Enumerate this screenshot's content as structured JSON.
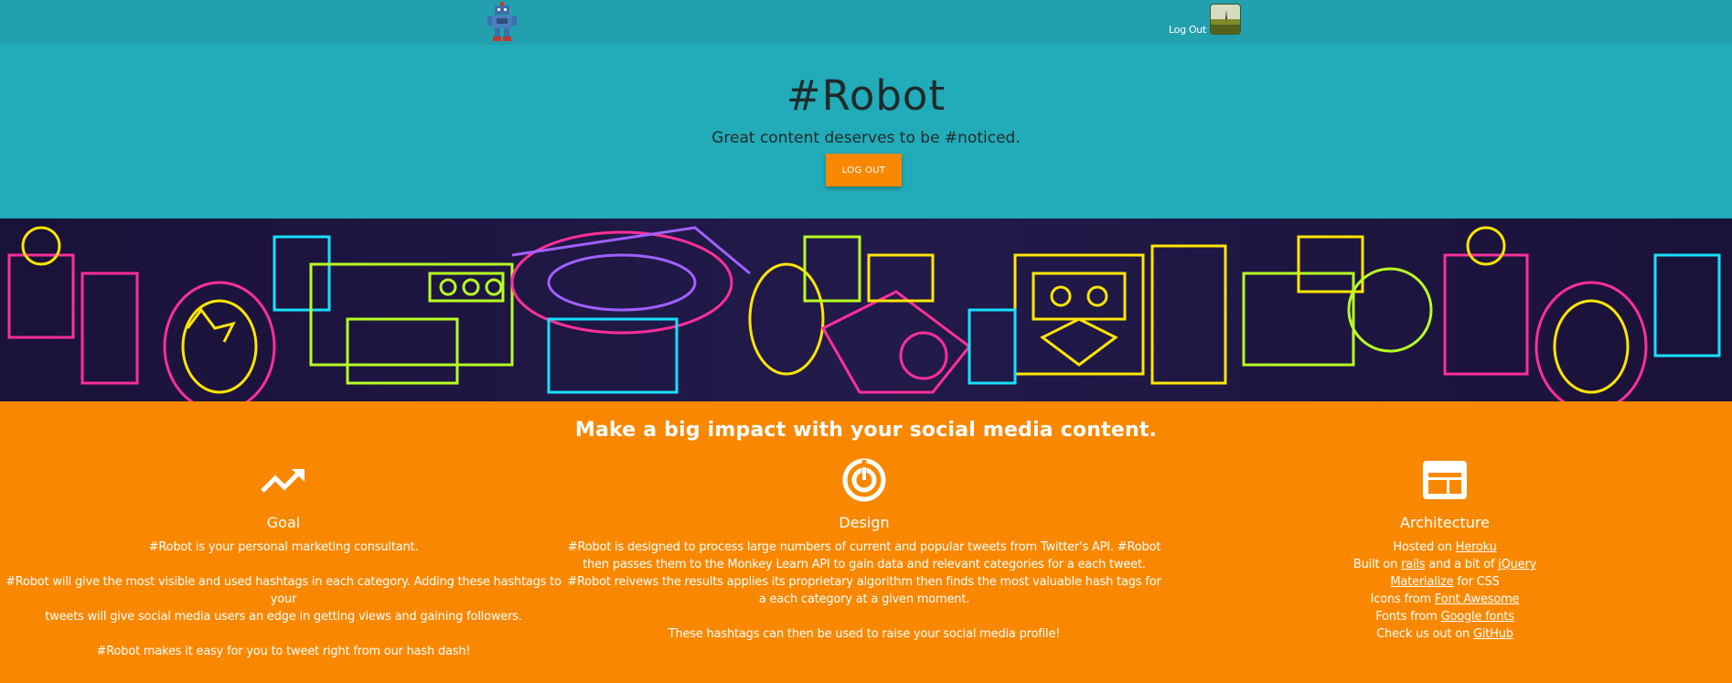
{
  "nav": {
    "logout_label": "Log Out"
  },
  "hero": {
    "title": "#Robot",
    "subtitle": "Great content deserves to be #noticed.",
    "button_label": "LOG OUT"
  },
  "features": {
    "heading": "Make a big impact with your social media content.",
    "goal": {
      "icon": "trending-up-icon",
      "title": "Goal",
      "p1": "#Robot is your personal marketing consultant.",
      "p2a": "#Robot will give the most visible and used hashtags in each category. Adding these hashtags to your",
      "p2b": "tweets will give social media users an edge in getting views and gaining followers.",
      "p3": "#Robot makes it easy for you to tweet right from our hash dash!"
    },
    "design": {
      "icon": "track-changes-icon",
      "title": "Design",
      "l1": "#Robot is designed to process large numbers of current and popular tweets from Twitter's API. #Robot",
      "l2": "then passes them to the Monkey Learn API to gain data and relevant categories for a each tweet.",
      "l3": "#Robot reivews the results applies its proprietary algorithm then finds the most valuable hash tags for",
      "l4": "a each category at a given moment.",
      "l5": "These hashtags can then be used to raise your social media profile!"
    },
    "architecture": {
      "icon": "web-layout-icon",
      "title": "Architecture",
      "hosted_prefix": "Hosted on ",
      "hosted_link": "Heroku",
      "built_prefix": "Built on ",
      "built_link1": "rails",
      "built_mid": " and a bit of ",
      "built_link2": "jQuery",
      "css_link": "Materialize",
      "css_suffix": " for CSS",
      "icons_prefix": "Icons from ",
      "icons_link": "Font Awesome",
      "fonts_prefix": "Fonts from ",
      "fonts_link": "Google fonts",
      "check_prefix": "Check us out on ",
      "check_link": "GitHub"
    }
  },
  "colors": {
    "nav": "#22a0ae",
    "hero": "#22abb8",
    "accent": "#f98800"
  }
}
